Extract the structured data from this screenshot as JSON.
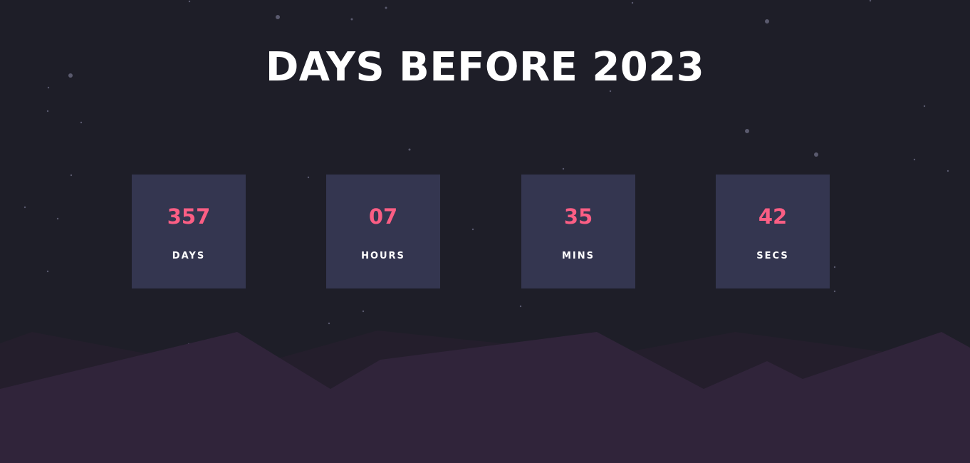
{
  "page": {
    "title": "DAYS BEFORE 2023"
  },
  "countdown": [
    {
      "value": "357",
      "label": "DAYS"
    },
    {
      "value": "07",
      "label": "HOURS"
    },
    {
      "value": "35",
      "label": "MINS"
    },
    {
      "value": "42",
      "label": "SECS"
    }
  ],
  "colors": {
    "background": "#1e1e28",
    "card": "#343650",
    "accent": "#fb5e84",
    "text": "#ffffff",
    "hills_back": "#241e2c",
    "hills_front": "#30243a"
  }
}
